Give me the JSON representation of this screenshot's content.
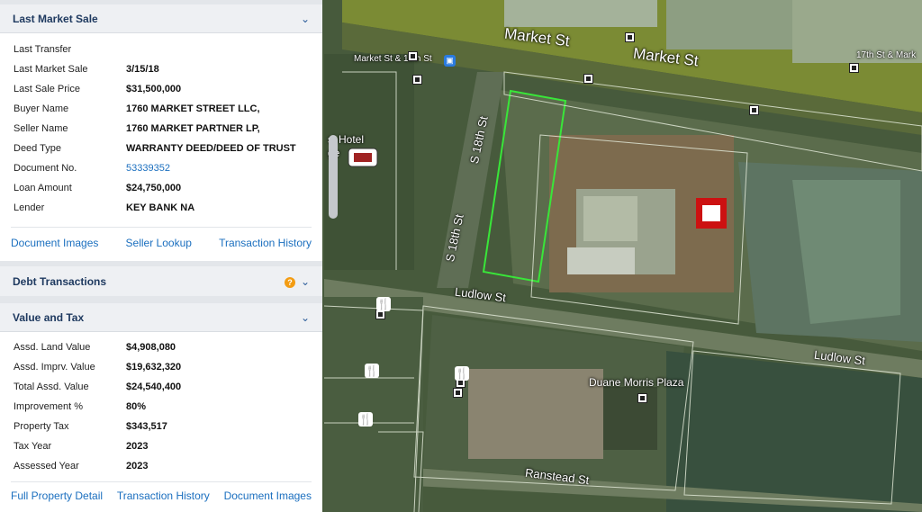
{
  "last_market_sale": {
    "title": "Last Market Sale",
    "rows": [
      {
        "label": "Last Transfer",
        "value": ""
      },
      {
        "label": "Last Market Sale",
        "value": "3/15/18"
      },
      {
        "label": "Last Sale Price",
        "value": "$31,500,000"
      },
      {
        "label": "Buyer Name",
        "value": "1760 MARKET STREET LLC,"
      },
      {
        "label": "Seller Name",
        "value": "1760 MARKET PARTNER LP,"
      },
      {
        "label": "Deed Type",
        "value": "WARRANTY DEED/DEED OF TRUST"
      },
      {
        "label": "Document No.",
        "value": "53339352"
      },
      {
        "label": "Loan Amount",
        "value": "$24,750,000"
      },
      {
        "label": "Lender",
        "value": "KEY BANK NA"
      }
    ],
    "actions": [
      "Document Images",
      "Seller Lookup",
      "Transaction History"
    ]
  },
  "debt_transactions": {
    "title": "Debt Transactions",
    "help": "?"
  },
  "value_and_tax": {
    "title": "Value and Tax",
    "rows": [
      {
        "label": "Assd. Land Value",
        "value": "$4,908,080"
      },
      {
        "label": "Assd. Imprv. Value",
        "value": "$19,632,320"
      },
      {
        "label": "Total Assd. Value",
        "value": "$24,540,400"
      },
      {
        "label": "Improvement %",
        "value": "80%"
      },
      {
        "label": "Property Tax",
        "value": "$343,517"
      },
      {
        "label": "Tax Year",
        "value": "2023"
      },
      {
        "label": "Assessed Year",
        "value": "2023"
      }
    ],
    "actions": [
      "Full Property Detail",
      "Transaction History",
      "Document Images"
    ]
  },
  "icons": {
    "chevron": "chevron-down-icon",
    "help": "question-icon"
  },
  "map": {
    "streets": {
      "market_1": "Market St",
      "market_2": "Market St",
      "s18_1": "S 18th St",
      "s18_2": "S 18th St",
      "ludlow_1": "Ludlow St",
      "ludlow_2": "Ludlow St",
      "ranstead": "Ranstead St"
    },
    "places": {
      "market_18th": "Market St & 18th St",
      "market_17th": "17th St & Mark",
      "hotel": "Hotel",
      "hotel_prefix": "s'",
      "hotel_suffix": "ge",
      "duane_morris": "Duane Morris Plaza"
    },
    "colors": {
      "highlight": "#39e639",
      "bank": "#cc1111"
    }
  }
}
